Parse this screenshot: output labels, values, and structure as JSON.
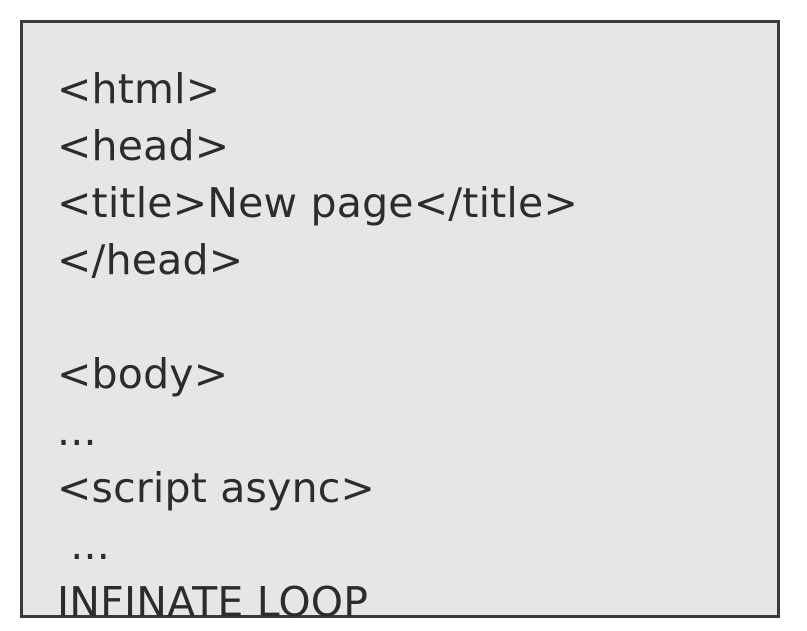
{
  "code": {
    "lines": [
      "<html>",
      "<head>",
      "<title>New page</title>",
      "</head>",
      "",
      "<body>",
      "...",
      "<script async>",
      " ...",
      "INFINATE LOOP"
    ]
  }
}
